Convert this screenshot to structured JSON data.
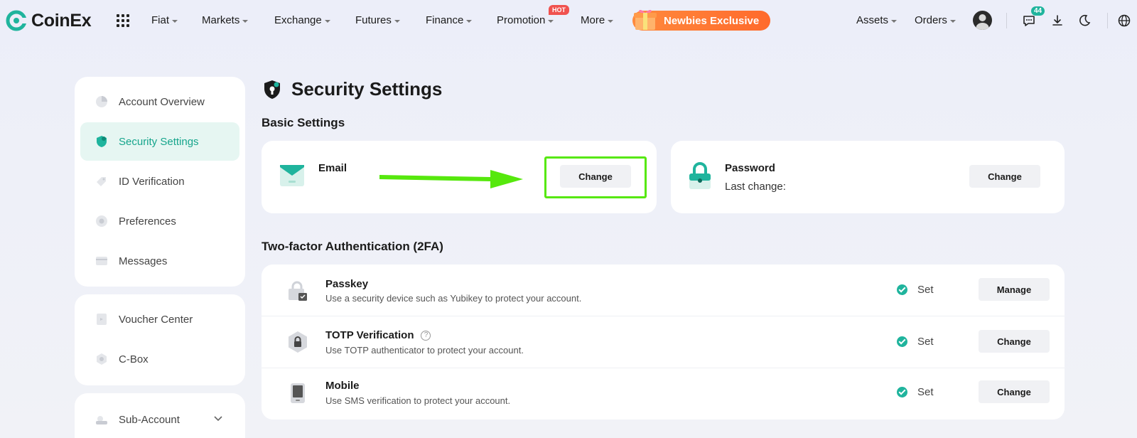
{
  "brand": {
    "name": "CoinEx"
  },
  "nav": {
    "items": [
      {
        "label": "Fiat"
      },
      {
        "label": "Markets"
      },
      {
        "label": "Exchange"
      },
      {
        "label": "Futures"
      },
      {
        "label": "Finance"
      },
      {
        "label": "Promotion"
      },
      {
        "label": "More"
      }
    ],
    "hot_badge": "HOT",
    "newbies_label": "Newbies Exclusive",
    "assets_label": "Assets",
    "orders_label": "Orders",
    "chat_count": "44"
  },
  "sidebar": {
    "group1": [
      {
        "label": "Account Overview",
        "icon": "pie-chart-icon"
      },
      {
        "label": "Security Settings",
        "icon": "shield-icon",
        "active": true
      },
      {
        "label": "ID Verification",
        "icon": "id-tag-icon"
      },
      {
        "label": "Preferences",
        "icon": "gear-icon"
      },
      {
        "label": "Messages",
        "icon": "message-icon"
      }
    ],
    "group2": [
      {
        "label": "Voucher Center",
        "icon": "voucher-icon"
      },
      {
        "label": "C-Box",
        "icon": "box-icon"
      }
    ],
    "group3": [
      {
        "label": "Sub-Account",
        "icon": "sub-account-icon"
      }
    ]
  },
  "main": {
    "title": "Security Settings",
    "basic_title": "Basic Settings",
    "email": {
      "label": "Email",
      "button": "Change"
    },
    "password": {
      "label": "Password",
      "sub": "Last change:",
      "button": "Change"
    },
    "tfa_title": "Two-factor Authentication (2FA)",
    "tfa_rows": [
      {
        "title": "Passkey",
        "desc": "Use a security device such as Yubikey to protect your account.",
        "status": "Set",
        "button": "Manage"
      },
      {
        "title": "TOTP Verification",
        "desc": "Use TOTP authenticator to protect your account.",
        "status": "Set",
        "button": "Change"
      },
      {
        "title": "Mobile",
        "desc": "Use SMS verification to protect your account.",
        "status": "Set",
        "button": "Change"
      }
    ]
  },
  "colors": {
    "accent": "#1fb49d",
    "annotation": "#56e80d",
    "promo": "#ff7a34"
  }
}
